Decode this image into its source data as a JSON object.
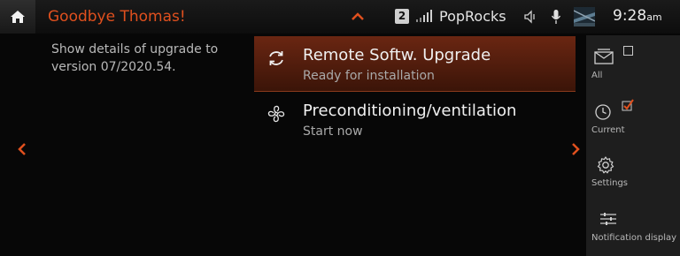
{
  "status_bar": {
    "greeting": "Goodbye Thomas!",
    "media_source_number": "2",
    "station_name": "PopRocks",
    "time": "9:28",
    "time_suffix": "am"
  },
  "detail": {
    "text": "Show details of upgrade to version 07/2020.54."
  },
  "notifications": [
    {
      "title": "Remote Softw. Upgrade",
      "subtitle": "Ready for installation",
      "icon": "refresh-icon",
      "selected": true
    },
    {
      "title": "Preconditioning/ventilation",
      "subtitle": "Start now",
      "icon": "fan-icon",
      "selected": false
    }
  ],
  "side_menu": {
    "items": [
      {
        "label": "All",
        "icon": "envelope-icon",
        "checkbox": "unchecked"
      },
      {
        "label": "Current",
        "icon": "clock-icon",
        "checkbox": "checked"
      },
      {
        "label": "Settings",
        "icon": "gear-icon"
      },
      {
        "label": "Notification display",
        "icon": "sliders-icon"
      }
    ]
  },
  "colors": {
    "accent": "#e0501e",
    "selected_row": "#5a200f",
    "side_panel": "#1e1e1e"
  }
}
